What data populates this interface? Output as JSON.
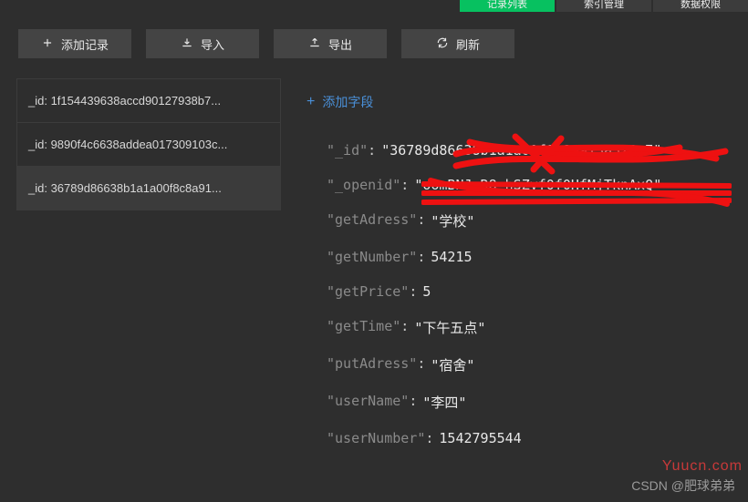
{
  "tabs": {
    "active": "记录列表",
    "t2": "索引管理",
    "t3": "数据权限"
  },
  "toolbar": {
    "add_label": "添加记录",
    "import_label": "导入",
    "export_label": "导出",
    "refresh_label": "刷新"
  },
  "records": {
    "items": [
      {
        "prefix": "_id: ",
        "text": "1f154439638accd90127938b7..."
      },
      {
        "prefix": "_id: ",
        "text": "9890f4c6638addea017309103c..."
      },
      {
        "prefix": "_id: ",
        "text": "36789d86638b1a1a00f8c8a91..."
      }
    ],
    "selected_index": 2
  },
  "detail": {
    "add_field_label": "添加字段",
    "fields": [
      {
        "key": "_id",
        "type": "string",
        "value": "36789d86638b1a1a00f8c8a913a328a7",
        "redacted": true
      },
      {
        "key": "_openid",
        "type": "string",
        "value": "o6mBNJoR8-hSZyf0f0HfMjTknAxQ",
        "redacted": true
      },
      {
        "key": "getAdress",
        "type": "string",
        "value": "学校"
      },
      {
        "key": "getNumber",
        "type": "number",
        "value": 54215
      },
      {
        "key": "getPrice",
        "type": "number",
        "value": 5
      },
      {
        "key": "getTime",
        "type": "string",
        "value": "下午五点"
      },
      {
        "key": "putAdress",
        "type": "string",
        "value": "宿舍"
      },
      {
        "key": "userName",
        "type": "string",
        "value": "李四"
      },
      {
        "key": "userNumber",
        "type": "number",
        "value": 1542795544
      }
    ]
  },
  "watermark": {
    "wm1": "Yuucn.com",
    "wm2": "CSDN @肥球弟弟"
  }
}
